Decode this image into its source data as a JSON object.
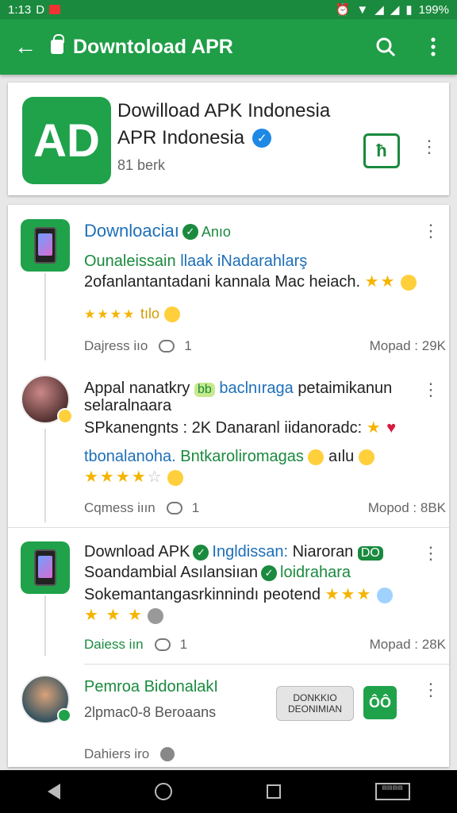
{
  "status": {
    "time": "1:13",
    "left_glyphs": "D",
    "battery": "199%"
  },
  "appbar": {
    "title": "Downtoload APR",
    "icons": [
      "back-arrow-icon",
      "lock-icon",
      "search-icon",
      "overflow-menu-icon"
    ]
  },
  "hero": {
    "title": "Dowilload APK Indonesia",
    "subtitle": "APR Indonesia",
    "meta": "81 berk",
    "logo_text": "AD",
    "install_glyph": "ħ"
  },
  "posts": [
    {
      "author": "Downloaciaı",
      "author_badge": "Anıo",
      "line1": "Ounaleissain",
      "line1_green": "llaak iNadarahlarş",
      "line2": "2ofanlantantadani  kannala Mac heiach.",
      "line2_stars": "★★",
      "line3_stars": "★★★★",
      "line3_text": "tılo",
      "footer_left": "Dajress iıo",
      "footer_count": "1",
      "footer_right": "Mopad : 29K"
    },
    {
      "author": "Appal nanatkry",
      "author_pill": "bb",
      "author_blue": "baclnıraga",
      "author_tail": "petaimikanun",
      "line1": "selaralnaara",
      "line2": "SPkanengnts : 2K  Danaranl iidanoradc:",
      "line2_star": "★",
      "line3": "tbonalanoha.",
      "line3_green": "Bntkaroliromagas",
      "line3_tail": "aılu",
      "line4_stars": "★★★★",
      "line4_half": "☆",
      "footer_left": "Cqmess iıın",
      "footer_count": "1",
      "footer_right": "Mopod : 8BK"
    },
    {
      "author": "Download APK",
      "author_green": "Ingldissan:",
      "author_tail": "Niaroran",
      "author_pill": "DO",
      "line1": "Soandambial Asılansiıan",
      "line1_green": "loidrahara",
      "line2": "Sokemantangasrkinnindı  peotend",
      "line2_stars": "★★★",
      "line3_stars": "★ ★ ★",
      "footer_left": "Daiess iın",
      "footer_count": "1",
      "footer_right": "Mopad : 28K"
    },
    {
      "author": "Pemroa BidonalakI",
      "line1": "2lpmac0-8 Beroaans",
      "button_line1": "DONKKIO",
      "button_line2": "DEONIMIAN",
      "button_glyph": "ÔÔ",
      "footer_left": "Dahiers iro"
    }
  ]
}
